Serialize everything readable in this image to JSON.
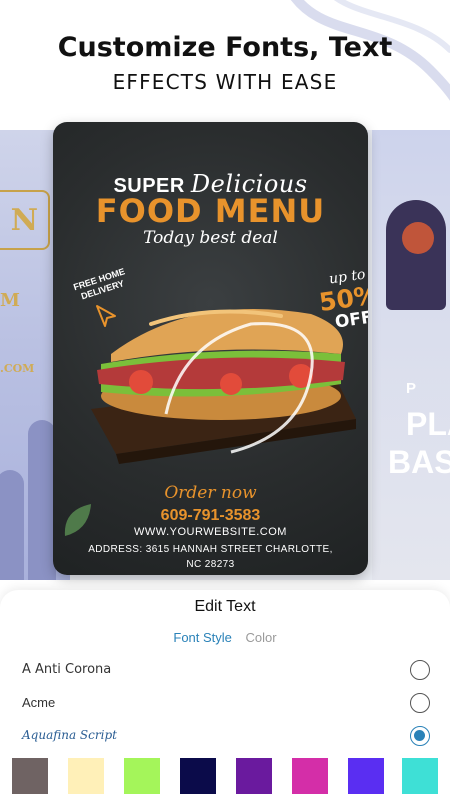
{
  "header": {
    "headline": "Customize Fonts, Text",
    "subline": "EFFECTS WITH EASE"
  },
  "carousel": {
    "left_card": {
      "text_big": "N",
      "text_m": "M",
      "text_com": ".COM"
    },
    "right_card": {
      "tag": "P",
      "line1": "PLA",
      "line2": "BASKI"
    }
  },
  "poster": {
    "super": "SUPER",
    "delicious": "Delicious",
    "food_menu": "FOOD MENU",
    "deal": "Today best deal",
    "delivery_line1": "FREE HOME",
    "delivery_line2": "DELIVERY",
    "up_to": "up to",
    "percent": "50%",
    "off": "OFF",
    "order_now": "Order now",
    "phone": "609-791-3583",
    "website": "WWW.YOURWEBSITE.COM",
    "address_line1": "ADDRESS: 3615 HANNAH STREET CHARLOTTE,",
    "address_line2": "NC 28273",
    "accent_color": "#e8932c"
  },
  "edit_sheet": {
    "title": "Edit Text",
    "tabs": [
      {
        "label": "Font Style",
        "active": true
      },
      {
        "label": "Color",
        "active": false
      }
    ],
    "fonts": [
      {
        "name": "A Anti Corona",
        "selected": false
      },
      {
        "name": "Acme",
        "selected": false
      },
      {
        "name": "Aquafina Script",
        "selected": true
      }
    ],
    "swatches": [
      "#6f6363",
      "#fff0b8",
      "#a4f55a",
      "#0b0b4a",
      "#6a1a9e",
      "#d42ea8",
      "#5a2ef2",
      "#3ee0d6"
    ]
  }
}
